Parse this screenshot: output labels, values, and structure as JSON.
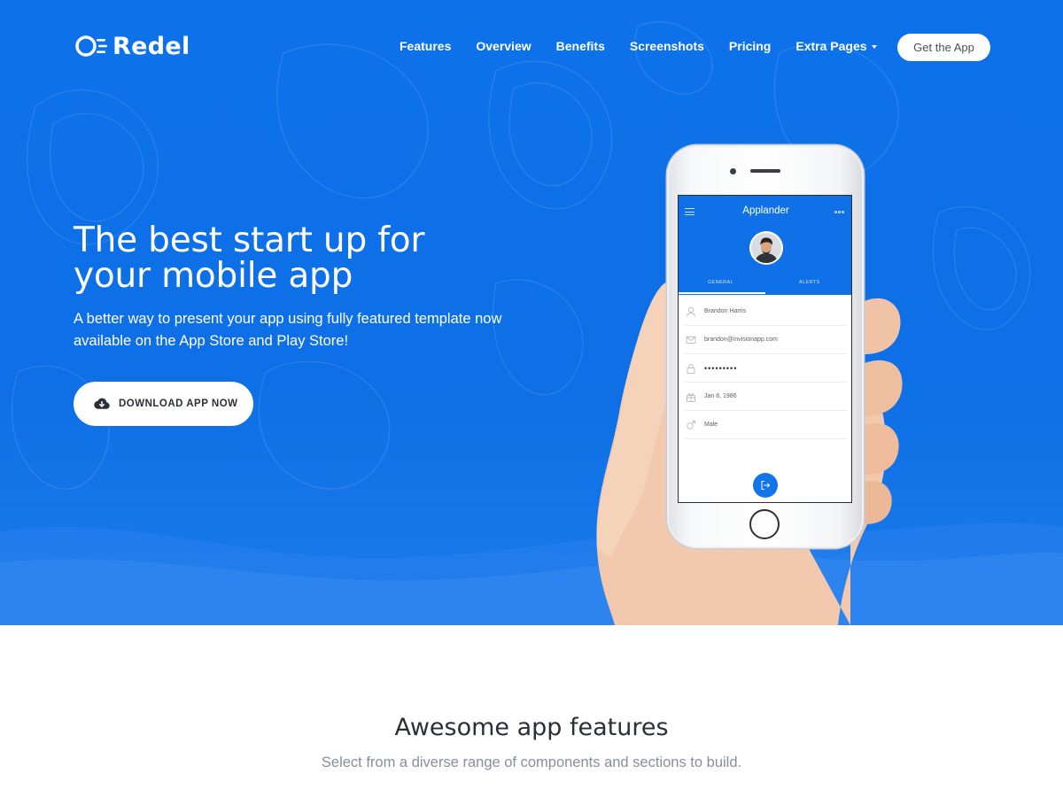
{
  "brand": {
    "name": "Redel"
  },
  "nav": {
    "items": [
      "Features",
      "Overview",
      "Benefits",
      "Screenshots",
      "Pricing",
      "Extra Pages"
    ],
    "cta": "Get the App"
  },
  "hero": {
    "title": "The best start up for your mobile app",
    "subtitle": "A better way to present your app using fully featured template now available on the App Store and Play Store!",
    "download_label": "DOWNLOAD APP NOW",
    "background_color": "#0e6fe6"
  },
  "phone_app": {
    "title": "Applander",
    "tabs": [
      "GENERAL",
      "ALERTS"
    ],
    "fields": {
      "name": "Brandon Harris",
      "email": "brandon@invisionapp.com",
      "password": "•••••••••",
      "birthday": "Jan 8, 1986",
      "gender": "Male"
    }
  },
  "features": {
    "title": "Awesome app features",
    "subtitle": "Select from a diverse range of components and sections to build."
  }
}
